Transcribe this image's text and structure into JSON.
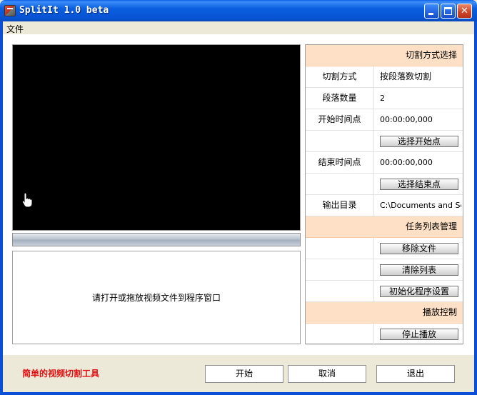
{
  "window": {
    "title": "SplitIt 1.0 beta"
  },
  "menu": {
    "file": "文件"
  },
  "video": {
    "cursor_icon": "hand-pointer-icon"
  },
  "drop_hint": "请打开或拖放视频文件到程序窗口",
  "panel": {
    "split_section": "切割方式选择",
    "split_mode": {
      "label": "切割方式",
      "value": "按段落数切割"
    },
    "segment_count": {
      "label": "段落数量",
      "value": "2"
    },
    "start_time": {
      "label": "开始时间点",
      "value": "00:00:00,000"
    },
    "choose_start": "选择开始点",
    "end_time": {
      "label": "结束时间点",
      "value": "00:00:00,000"
    },
    "choose_end": "选择结束点",
    "output_dir": {
      "label": "输出目录",
      "value": "C:\\Documents and Sett"
    },
    "task_section": "任务列表管理",
    "remove_file": "移除文件",
    "clear_list": "清除列表",
    "init_settings": "初始化程序设置",
    "playback_section": "播放控制",
    "stop_playback": "停止播放"
  },
  "footer": {
    "tagline": "简单的视频切割工具",
    "start": "开始",
    "cancel": "取消",
    "quit": "退出"
  },
  "colors": {
    "titlebar": "#0a5fe0",
    "section_header": "#fde0c5",
    "tagline": "#e01010",
    "window_bg": "#ece9d8"
  }
}
